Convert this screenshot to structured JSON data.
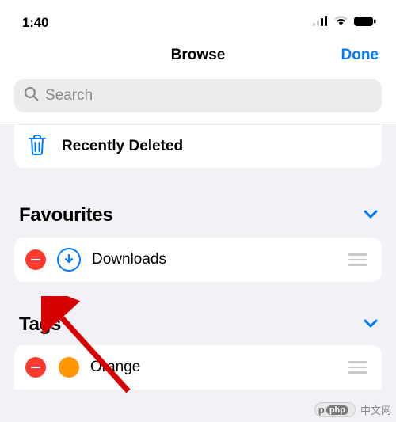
{
  "status": {
    "time": "1:40"
  },
  "nav": {
    "title": "Browse",
    "done": "Done"
  },
  "search": {
    "placeholder": "Search"
  },
  "locations": {
    "recently_deleted": "Recently Deleted"
  },
  "sections": {
    "favourites": {
      "title": "Favourites",
      "items": [
        {
          "label": "Downloads"
        }
      ]
    },
    "tags": {
      "title": "Tags",
      "items": [
        {
          "label": "Orange",
          "color": "#ff9500"
        }
      ]
    }
  },
  "watermark": {
    "brand": "php",
    "text": "中文网"
  }
}
